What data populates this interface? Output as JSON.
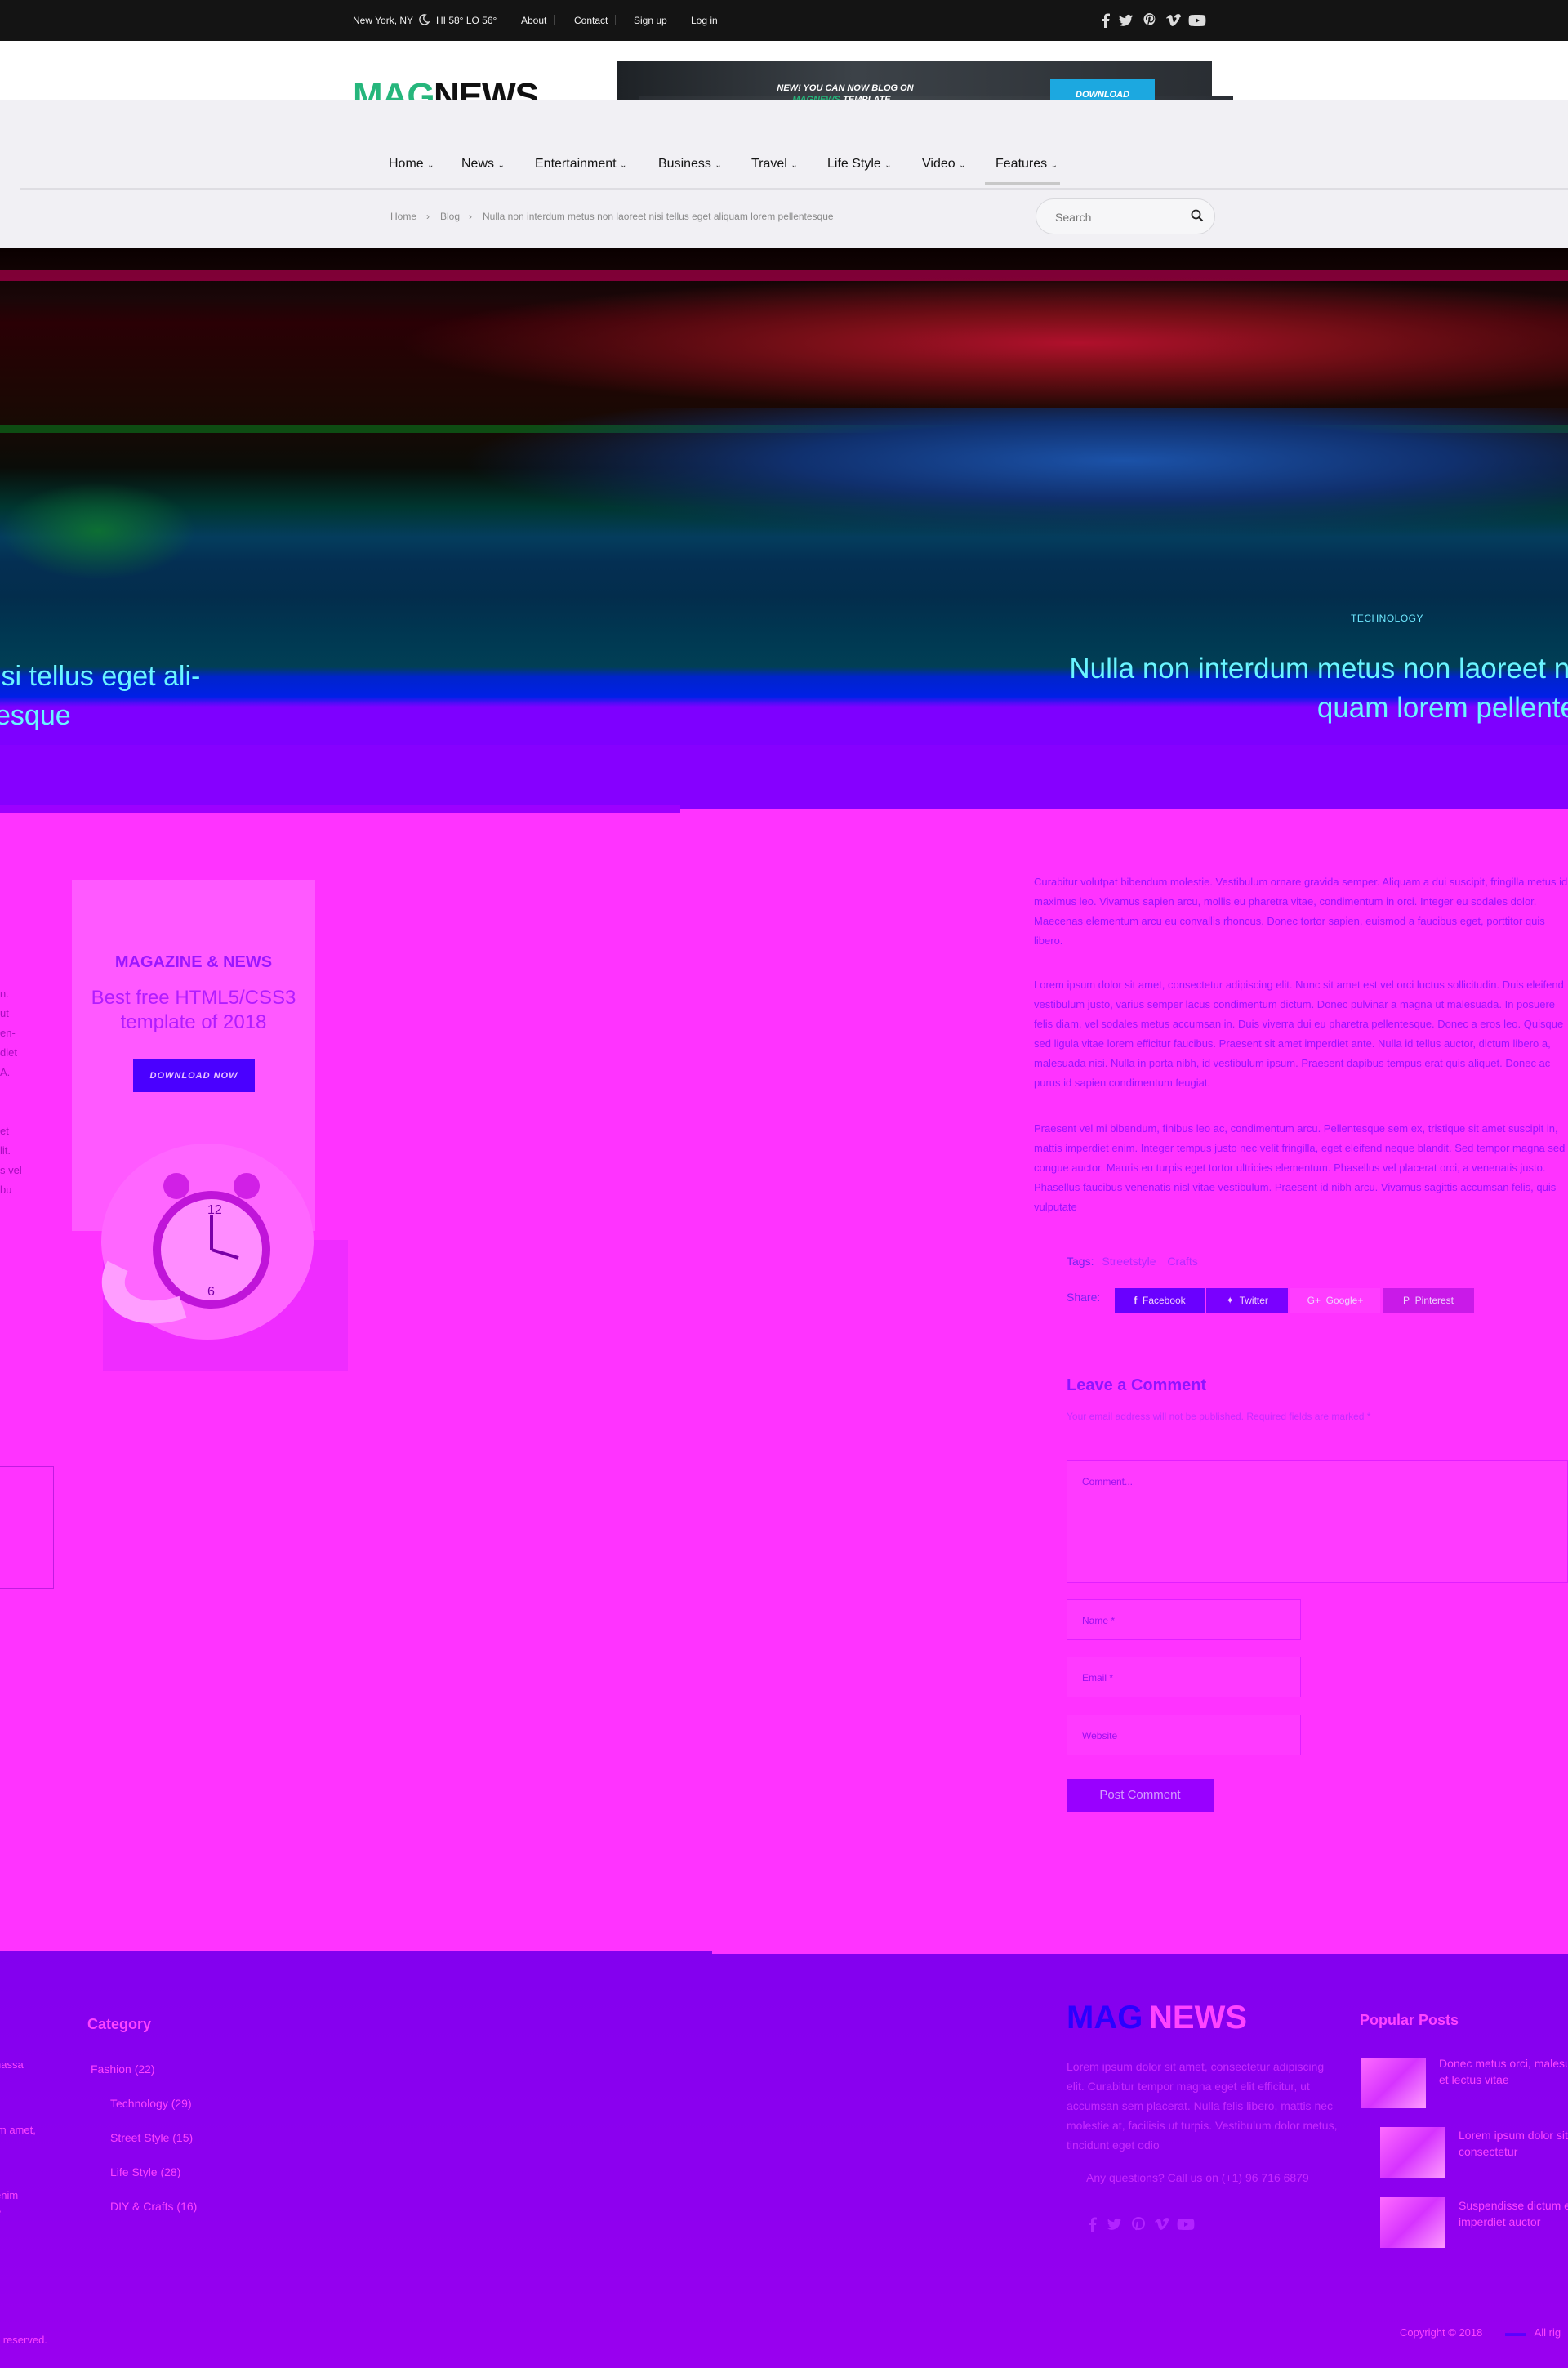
{
  "topbar": {
    "location": "New York, NY",
    "weather": "HI 58° LO 56°",
    "links": [
      "About",
      "Contact",
      "Sign up",
      "Log in"
    ],
    "social_icons": [
      "facebook-icon",
      "twitter-icon",
      "pinterest-icon",
      "vimeo-icon",
      "youtube-icon"
    ]
  },
  "header": {
    "logo_part1": "MAG",
    "logo_part2": "NEWS",
    "banner": {
      "text_new": "NEW!",
      "text_line1": " YOU CAN NOW BLOG ON",
      "text_brand": "MAGNEWS",
      "text_line2": " TEMPLATE...",
      "button_label": "DOWNLOAD"
    }
  },
  "nav": {
    "items": [
      "Home",
      "News",
      "Entertainment",
      "Business",
      "Travel",
      "Life Style",
      "Video",
      "Features"
    ],
    "active": "Features"
  },
  "breadcrumb": [
    "Home",
    "Blog",
    "Nulla non interdum metus non laoreet nisi tellus eget aliquam lorem pellentesque"
  ],
  "search": {
    "placeholder": "Search"
  },
  "hero": {
    "category": "TECHNOLOGY",
    "title_line1": "Nulla non interdum metus non laoreet ni",
    "title_line2": "quam lorem pellente",
    "title_left_line1": "isi tellus eget ali-",
    "title_left_line2": "esque"
  },
  "ad": {
    "title": "MAGAZINE & NEWS",
    "subtitle_line1": "Best free HTML5/CSS3",
    "subtitle_line2": "template of 2018",
    "button_label": "DOWNLOAD NOW"
  },
  "left_snippets": [
    "n.",
    "ut",
    "en-",
    "diet",
    "A.",
    "",
    "",
    "et",
    "lit.",
    "s vel",
    "bu"
  ],
  "article": {
    "paragraphs": [
      "Curabitur volutpat bibendum molestie. Vestibulum ornare gravida semper. Aliquam a dui suscipit, fringilla metus id, maximus leo. Vivamus sapien arcu, mollis eu pharetra vitae, condimentum in orci. Integer eu sodales dolor. Maecenas elementum arcu eu convallis rhoncus. Donec tortor sapien, euismod a faucibus eget, porttitor quis libero.",
      "Lorem ipsum dolor sit amet, consectetur adipiscing elit. Nunc sit amet est vel orci luctus sollicitudin. Duis eleifend vestibulum justo, varius semper lacus condimentum dictum. Donec pulvinar a magna ut malesuada. In posuere felis diam, vel sodales metus accumsan in. Duis viverra dui eu pharetra pellentesque. Donec a eros leo. Quisque sed ligula vitae lorem efficitur faucibus. Praesent sit amet imperdiet ante. Nulla id tellus auctor, dictum libero a, malesuada nisi. Nulla in porta nibh, id vestibulum ipsum. Praesent dapibus tempus erat quis aliquet. Donec ac purus id sapien condimentum feugiat.",
      "Praesent vel mi bibendum, finibus leo ac, condimentum arcu. Pellentesque sem ex, tristique sit amet suscipit in, mattis imperdiet enim. Integer tempus justo nec velit fringilla, eget eleifend neque blandit. Sed tempor magna sed congue auctor. Mauris eu turpis eget tortor ultricies elementum. Phasellus vel placerat orci, a venenatis justo. Phasellus faucibus venenatis nisl vitae vestibulum. Praesent id nibh arcu. Vivamus sagittis accumsan felis, quis vulputate"
    ],
    "tags_label": "Tags:",
    "tags": [
      "Streetstyle",
      "Crafts"
    ],
    "share_label": "Share:",
    "share_buttons": [
      {
        "label": "Facebook",
        "color": "#6a00ff"
      },
      {
        "label": "Twitter",
        "color": "#7a00ff"
      },
      {
        "label": "Google+",
        "color": "#ff3dff"
      },
      {
        "label": "Pinterest",
        "color": "#c91ae8"
      }
    ]
  },
  "comment_form": {
    "title": "Leave a Comment",
    "note": "Your email address will not be published. Required fields are marked *",
    "comment_placeholder": "Comment...",
    "name_placeholder": "Name *",
    "email_placeholder": "Email *",
    "website_placeholder": "Website",
    "submit_label": "Post Comment"
  },
  "footer": {
    "category_title": "Category",
    "categories": [
      "Fashion (22)",
      "Technology (29)",
      "Street Style (15)",
      "Life Style (28)",
      "DIY & Crafts (16)"
    ],
    "logo_part1": "MAG",
    "logo_part2": "NEWS",
    "description": "Lorem ipsum dolor sit amet, consectetur adipiscing elit. Curabitur tempor magna eget elit efficitur, ut accumsan sem placerat. Nulla felis libero, mattis nec molestie at, facilisis ut turpis. Vestibulum dolor metus, tincidunt eget odio",
    "contact": "Any questions? Call us on (+1) 96 716 6879",
    "social_icons": [
      "facebook-icon",
      "twitter-icon",
      "pinterest-icon",
      "vimeo-icon",
      "youtube-icon"
    ],
    "popular_title": "Popular Posts",
    "popular_posts": [
      "Donec metus orci, malesuada et lectus vitae",
      "Lorem ipsum dolor sit amet, consectetur",
      "Suspendisse dictum enim quis imperdiet auctor"
    ],
    "left_snippets": [
      "nassa",
      "",
      "",
      "im amet,",
      "",
      "",
      "enim",
      "e"
    ],
    "copyright": "Copyright © 2018",
    "copyright_tail": "All rig",
    "rights": "ts reserved."
  }
}
